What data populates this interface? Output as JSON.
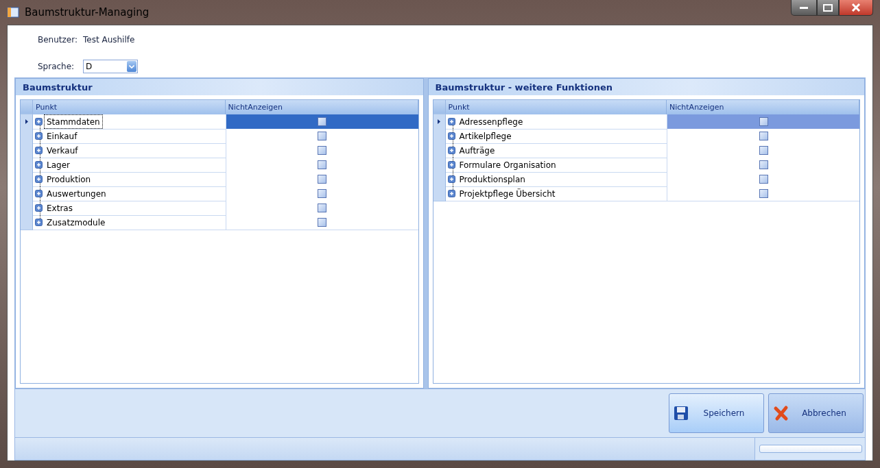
{
  "window": {
    "title": "Baumstruktur-Managing"
  },
  "user": {
    "label": "Benutzer:",
    "value": "Test Aushilfe"
  },
  "language": {
    "label": "Sprache:",
    "value": "D"
  },
  "panels": [
    {
      "title": "Baumstruktur",
      "focused": true,
      "columns": [
        "Punkt",
        "NichtAnzeigen"
      ],
      "rows": [
        {
          "label": "Stammdaten",
          "selected": true,
          "checked": false
        },
        {
          "label": "Einkauf",
          "selected": false,
          "checked": false
        },
        {
          "label": "Verkauf",
          "selected": false,
          "checked": false
        },
        {
          "label": "Lager",
          "selected": false,
          "checked": false
        },
        {
          "label": "Produktion",
          "selected": false,
          "checked": false
        },
        {
          "label": "Auswertungen",
          "selected": false,
          "checked": false
        },
        {
          "label": "Extras",
          "selected": false,
          "checked": false
        },
        {
          "label": "Zusatzmodule",
          "selected": false,
          "checked": false
        }
      ]
    },
    {
      "title": "Baumstruktur - weitere Funktionen",
      "focused": false,
      "columns": [
        "Punkt",
        "NichtAnzeigen"
      ],
      "rows": [
        {
          "label": "Adressenpflege",
          "selected": true,
          "checked": false
        },
        {
          "label": "Artikelpflege",
          "selected": false,
          "checked": false
        },
        {
          "label": "Aufträge",
          "selected": false,
          "checked": false
        },
        {
          "label": "Formulare Organisation",
          "selected": false,
          "checked": false
        },
        {
          "label": "Produktionsplan",
          "selected": false,
          "checked": false
        },
        {
          "label": "Projektpflege Übersicht",
          "selected": false,
          "checked": false
        }
      ]
    }
  ],
  "buttons": [
    {
      "label": "Speichern",
      "kind": "save"
    },
    {
      "label": "Abbrechen",
      "kind": "cancel"
    }
  ],
  "status_bar": {
    "progress": {
      "level": 0
    }
  }
}
